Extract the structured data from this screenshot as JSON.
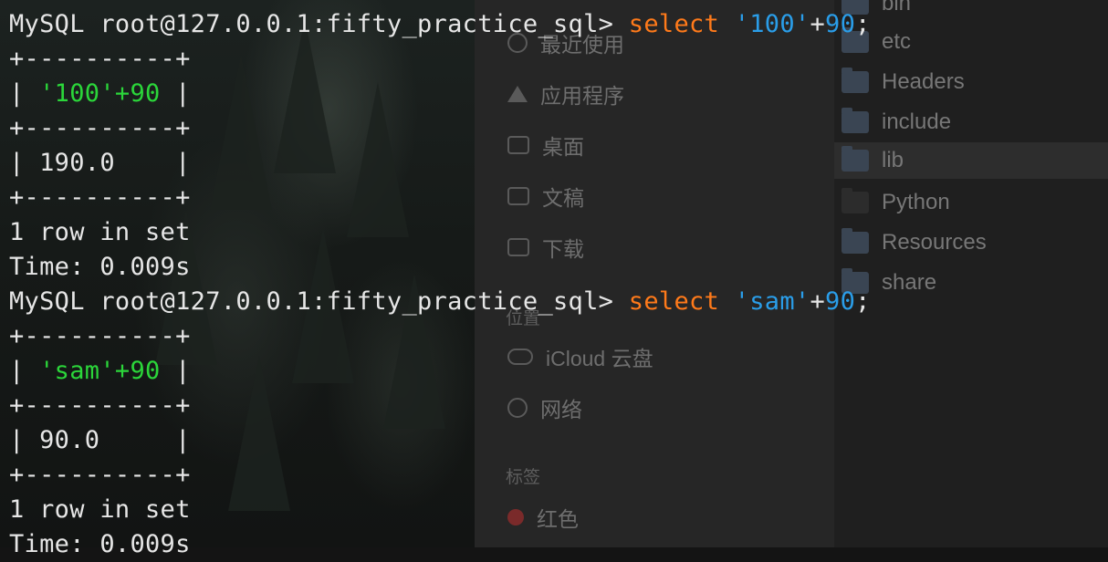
{
  "finder": {
    "sidebar": {
      "items": [
        {
          "label": "最近使用",
          "icon": "clock-icon"
        },
        {
          "label": "应用程序",
          "icon": "applications-icon"
        },
        {
          "label": "桌面",
          "icon": "desktop-folder-icon"
        },
        {
          "label": "文稿",
          "icon": "documents-folder-icon"
        },
        {
          "label": "下载",
          "icon": "downloads-folder-icon"
        }
      ],
      "section_location": "位置",
      "location_items": [
        {
          "label": "iCloud 云盘",
          "icon": "cloud-icon"
        },
        {
          "label": "网络",
          "icon": "network-icon"
        }
      ],
      "section_tags": "标签",
      "tag_items": [
        {
          "label": "红色",
          "icon": "red-tag-icon",
          "color": "#7a2a2a"
        }
      ]
    },
    "list": {
      "items": [
        {
          "label": "bin",
          "icon": "folder-icon"
        },
        {
          "label": "etc",
          "icon": "folder-icon"
        },
        {
          "label": "Headers",
          "icon": "folder-alias-icon"
        },
        {
          "label": "include",
          "icon": "folder-icon"
        },
        {
          "label": "lib",
          "icon": "folder-icon",
          "selected": true
        },
        {
          "label": "Python",
          "icon": "executable-icon"
        },
        {
          "label": "Resources",
          "icon": "folder-icon"
        },
        {
          "label": "share",
          "icon": "folder-icon"
        }
      ]
    }
  },
  "terminal": {
    "colors": {
      "text": "#e6e6e6",
      "keyword": "#ff7a1a",
      "string": "#2a9de8",
      "number": "#2a9de8",
      "header": "#2bd63a"
    },
    "queries": [
      {
        "prompt": "MySQL root@127.0.0.1:fifty_practice_sql> ",
        "keyword": "select",
        "string": "'100'",
        "op": "+",
        "number": "90",
        "end": ";",
        "border": "+----------+",
        "header_left": "| ",
        "header": "'100'+90",
        "header_right": " |",
        "row": "| 190.0    |",
        "summary": "1 row in set",
        "time": "Time: 0.009s"
      },
      {
        "prompt": "MySQL root@127.0.0.1:fifty_practice_sql> ",
        "keyword": "select",
        "string": "'sam'",
        "op": "+",
        "number": "90",
        "end": ";",
        "border": "+----------+",
        "header_left": "| ",
        "header": "'sam'+90",
        "header_right": " |",
        "row": "| 90.0     |",
        "summary": "1 row in set",
        "time": "Time: 0.009s"
      }
    ]
  }
}
